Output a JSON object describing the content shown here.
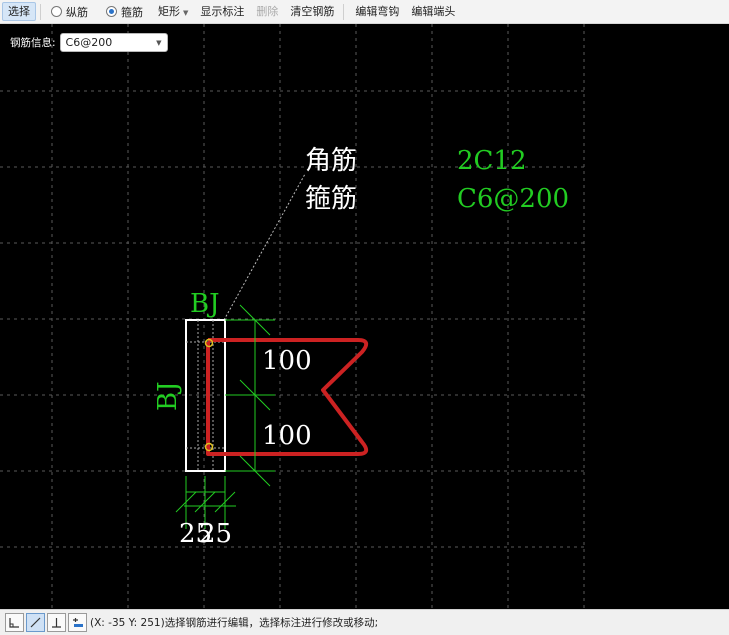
{
  "toolbar": {
    "select_label": "选择",
    "longitudinal_label": "纵筋",
    "stirrup_label": "箍筋",
    "shape_label": "矩形",
    "show_annotation_label": "显示标注",
    "delete_label": "删除",
    "clear_rebar_label": "清空钢筋",
    "edit_hook_label": "编辑弯钩",
    "edit_end_label": "编辑端头"
  },
  "rebar_info": {
    "label": "钢筋信息:",
    "value": "C6@200"
  },
  "canvas": {
    "label_corner": "角筋",
    "label_stirrup": "箍筋",
    "value_corner": "2C12",
    "value_stirrup": "C6@200",
    "dim_top_label": "BJ",
    "dim_left_label": "BJ",
    "dim_upper": "100",
    "dim_lower": "100",
    "dim_bottom": "25",
    "dim_bottom_2": "25"
  },
  "statusbar": {
    "coords": "(X: -35 Y: 251)",
    "message": "选择钢筋进行编辑，选择标注进行修改或移动;"
  },
  "colors": {
    "canvas_bg": "#000000",
    "grid": "#555555",
    "annotation_green": "#22cc22",
    "rebar_red": "#cc2222",
    "outline_white": "#ffffff",
    "corner_yellow": "#e0c020"
  }
}
